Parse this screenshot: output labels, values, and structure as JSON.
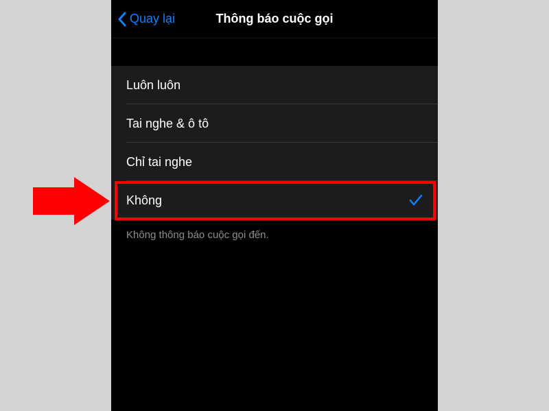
{
  "nav": {
    "back_label": "Quay lại",
    "title": "Thông báo cuộc gọi"
  },
  "options": [
    {
      "label": "Luôn luôn",
      "selected": false
    },
    {
      "label": "Tai nghe & ô tô",
      "selected": false
    },
    {
      "label": "Chỉ tai nghe",
      "selected": false
    },
    {
      "label": "Không",
      "selected": true
    }
  ],
  "footer": {
    "text": "Không thông báo cuộc gọi đến."
  },
  "annotation": {
    "highlighted_index": 3
  }
}
